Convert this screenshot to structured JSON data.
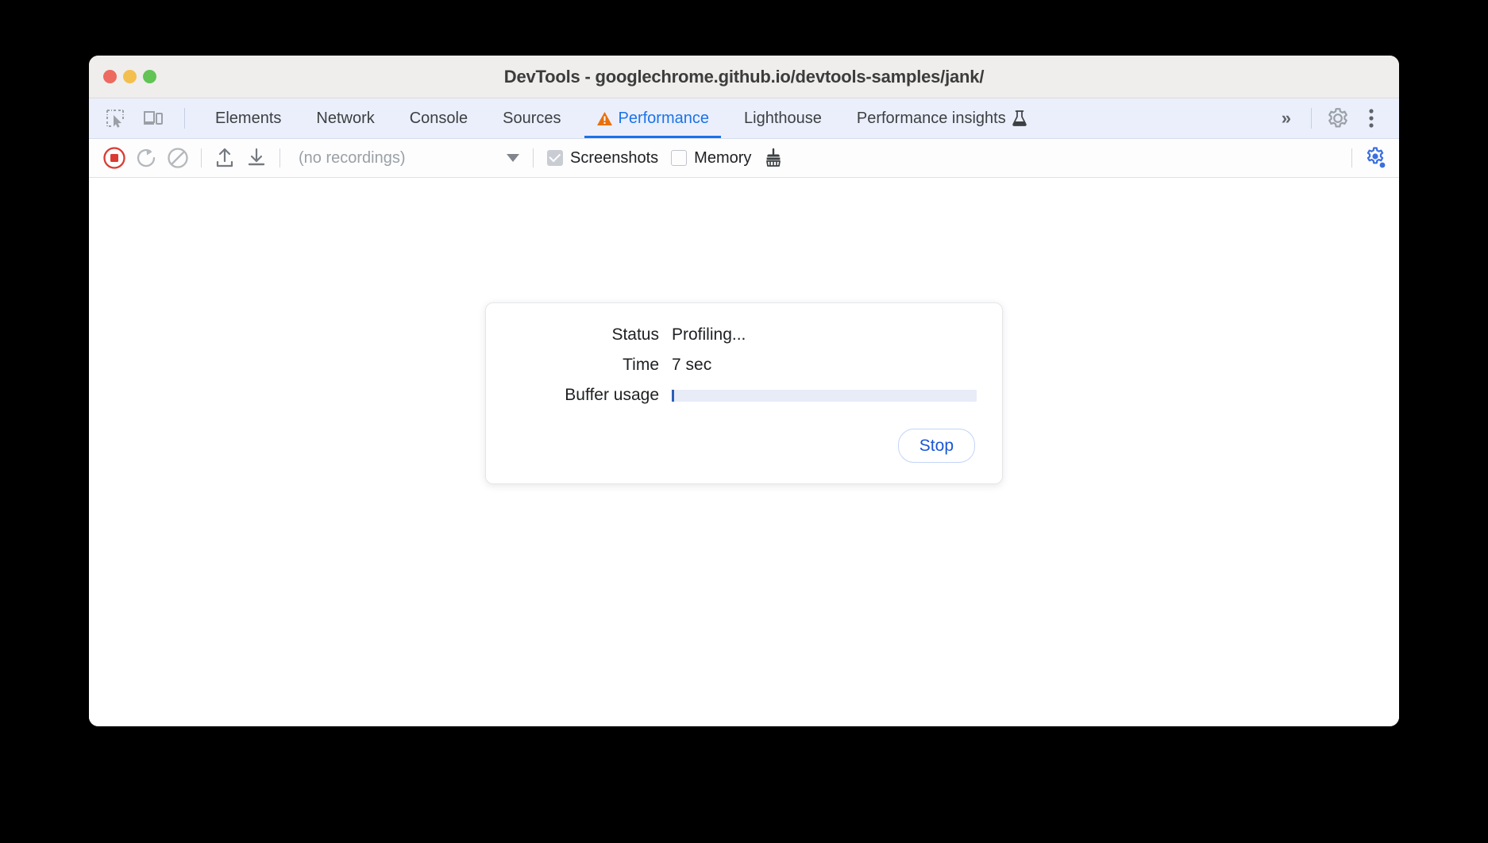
{
  "window": {
    "title": "DevTools - googlechrome.github.io/devtools-samples/jank/",
    "traffic_lights": [
      {
        "name": "close",
        "color": "#ec6a5f"
      },
      {
        "name": "minimize",
        "color": "#f3bf4f"
      },
      {
        "name": "zoom",
        "color": "#61c454"
      }
    ]
  },
  "tabbar": {
    "left_icons": [
      {
        "name": "inspect-element-icon",
        "title": "Inspect"
      },
      {
        "name": "device-toolbar-icon",
        "title": "Toggle device toolbar"
      }
    ],
    "tabs": [
      {
        "label": "Elements",
        "active": false,
        "warning": false,
        "experiment": false
      },
      {
        "label": "Network",
        "active": false,
        "warning": false,
        "experiment": false
      },
      {
        "label": "Console",
        "active": false,
        "warning": false,
        "experiment": false
      },
      {
        "label": "Sources",
        "active": false,
        "warning": false,
        "experiment": false
      },
      {
        "label": "Performance",
        "active": true,
        "warning": true,
        "experiment": false
      },
      {
        "label": "Lighthouse",
        "active": false,
        "warning": false,
        "experiment": false
      },
      {
        "label": "Performance insights",
        "active": false,
        "warning": false,
        "experiment": true
      }
    ],
    "more_tabs_label": "»",
    "right_icons": [
      {
        "name": "settings-gear-icon",
        "title": "Settings"
      },
      {
        "name": "more-options-icon",
        "title": "Customize and control DevTools"
      }
    ],
    "active_color": "#1a73e8",
    "warning_color": "#e8710a"
  },
  "toolbar": {
    "record_button": {
      "name": "stop-recording-button",
      "state": "recording",
      "color": "#db3a34"
    },
    "reload_button": {
      "name": "reload-and-record-button"
    },
    "clear_button": {
      "name": "clear-recording-button"
    },
    "upload_button": {
      "name": "load-profile-button"
    },
    "download_button": {
      "name": "save-profile-button"
    },
    "recordings_dropdown": {
      "value": "(no recordings)",
      "placeholder": "(no recordings)"
    },
    "screenshots_checkbox": {
      "label": "Screenshots",
      "checked": true,
      "disabled": true
    },
    "memory_checkbox": {
      "label": "Memory",
      "checked": false,
      "disabled": false
    },
    "garbage_collect_button": {
      "name": "collect-garbage-button"
    },
    "capture_settings_button": {
      "name": "capture-settings-gear-icon",
      "color": "#3b6ee0"
    }
  },
  "dialog": {
    "rows": [
      {
        "label": "Status",
        "value": "Profiling..."
      },
      {
        "label": "Time",
        "value": "7 sec"
      },
      {
        "label": "Buffer usage",
        "value": ""
      }
    ],
    "buffer_usage_percent": 0.4,
    "stop_label": "Stop"
  }
}
